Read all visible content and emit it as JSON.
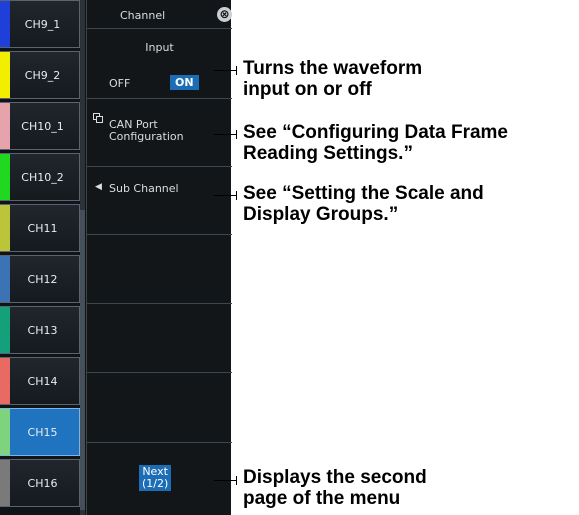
{
  "channels": [
    {
      "label": "CH9_1",
      "color": "#1e40d8",
      "selected": false
    },
    {
      "label": "CH9_2",
      "color": "#f2ee00",
      "selected": false
    },
    {
      "label": "CH10_1",
      "color": "#e7a3ac",
      "selected": false
    },
    {
      "label": "CH10_2",
      "color": "#1fd81f",
      "selected": false
    },
    {
      "label": "CH11",
      "color": "#bcc43a",
      "selected": false
    },
    {
      "label": "CH12",
      "color": "#3c73b5",
      "selected": false
    },
    {
      "label": "CH13",
      "color": "#13a07a",
      "selected": false
    },
    {
      "label": "CH14",
      "color": "#e86a62",
      "selected": false
    },
    {
      "label": "CH15",
      "color": "#7fd27e",
      "selected": true
    },
    {
      "label": "CH16",
      "color": "#7a7a7a",
      "selected": false
    }
  ],
  "menu": {
    "title": "Channel",
    "close_icon": "⊗",
    "input": {
      "label": "Input",
      "off_label": "OFF",
      "on_label": "ON"
    },
    "can_port": {
      "line1": "CAN Port",
      "line2": "Configuration"
    },
    "sub_channel": {
      "label": "Sub Channel"
    },
    "next": {
      "line1": "Next",
      "line2": "(1/2)"
    }
  },
  "callouts": {
    "input": "Turns the waveform\ninput on or off",
    "can_port": "See “Configuring Data Frame\nReading Settings.”",
    "sub_channel": "See “Setting the Scale and\nDisplay Groups.”",
    "next": "Displays the second\npage of the menu"
  },
  "colors": {
    "accent": "#1b6eb6",
    "panel": "#121618"
  }
}
